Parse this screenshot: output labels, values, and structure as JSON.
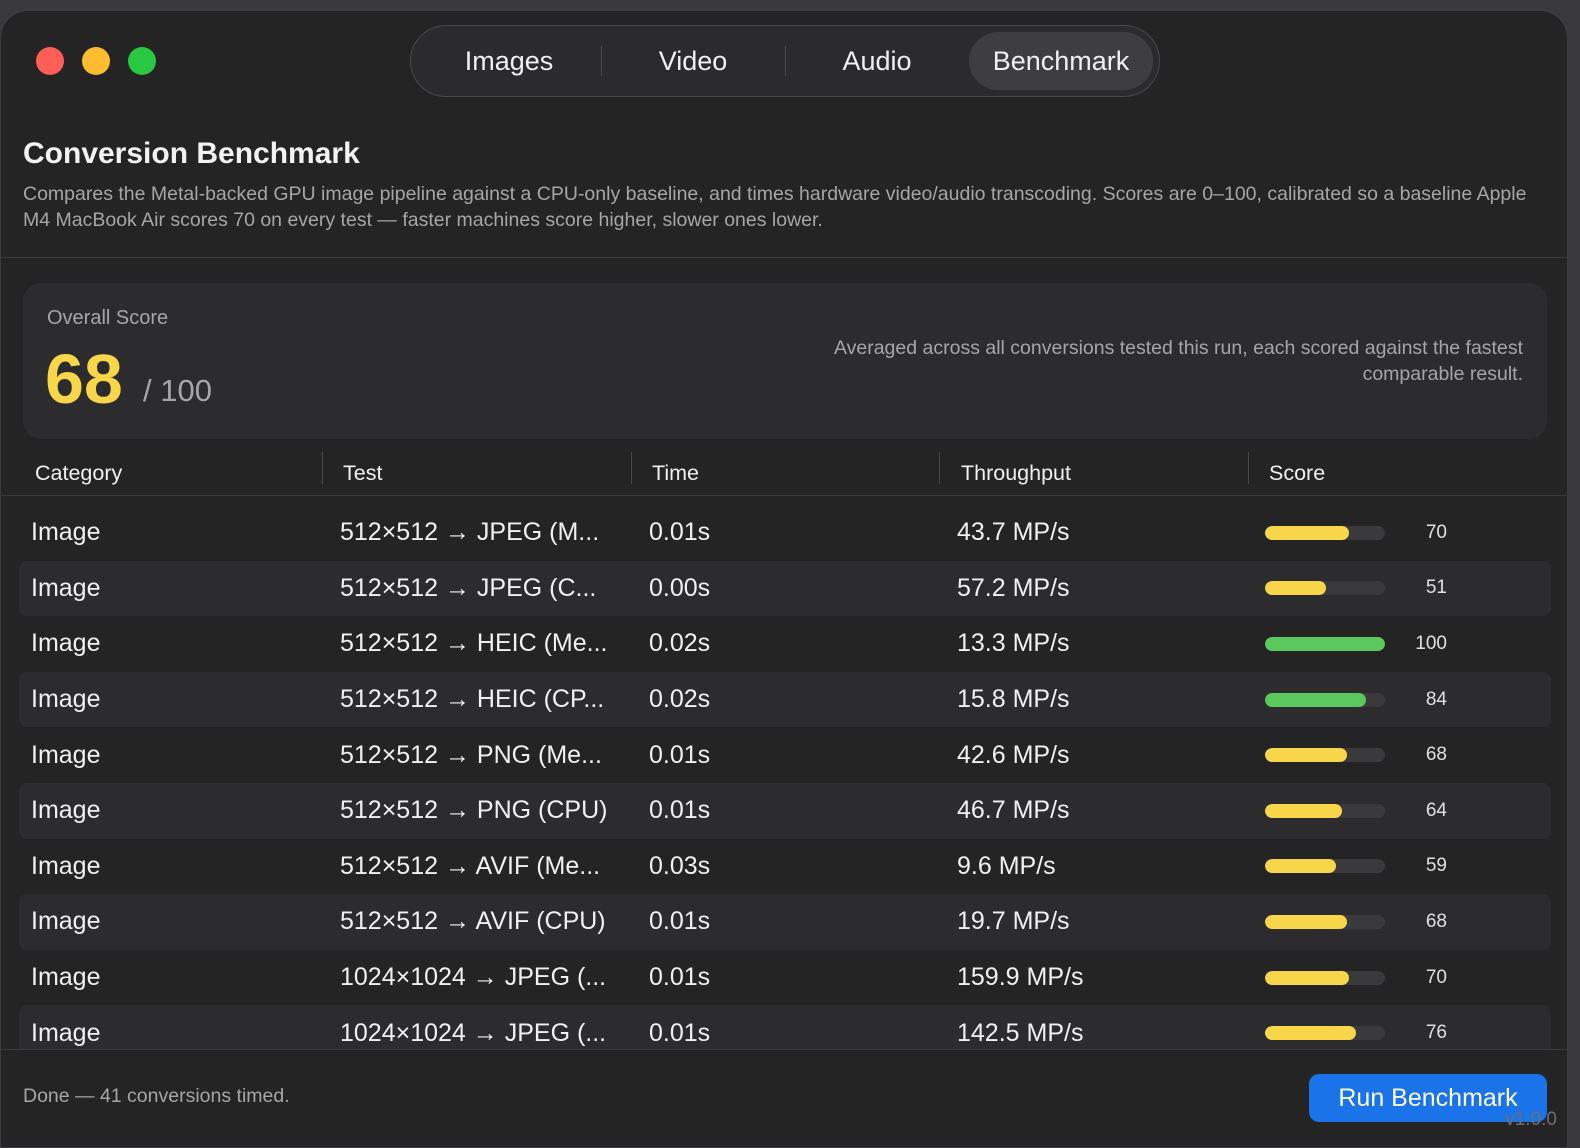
{
  "tabs": [
    {
      "label": "Images",
      "active": false
    },
    {
      "label": "Video",
      "active": false
    },
    {
      "label": "Audio",
      "active": false
    },
    {
      "label": "Benchmark",
      "active": true
    }
  ],
  "header": {
    "title": "Conversion Benchmark",
    "description": "Compares the Metal-backed GPU image pipeline against a CPU-only baseline, and times hardware video/audio transcoding. Scores are 0–100, calibrated so a baseline Apple M4 MacBook Air scores 70 on every test — faster machines score higher, slower ones lower."
  },
  "overall": {
    "label": "Overall Score",
    "score": "68",
    "max": "/ 100",
    "note": "Averaged across all conversions tested this run, each scored against the fastest comparable result."
  },
  "table": {
    "columns": [
      "Category",
      "Test",
      "Time",
      "Throughput",
      "Score"
    ],
    "rows": [
      {
        "category": "Image",
        "test": "512×512 → JPEG (M...",
        "time": "0.01s",
        "throughput": "43.7 MP/s",
        "score": 70
      },
      {
        "category": "Image",
        "test": "512×512 → JPEG (C...",
        "time": "0.00s",
        "throughput": "57.2 MP/s",
        "score": 51
      },
      {
        "category": "Image",
        "test": "512×512 → HEIC (Me...",
        "time": "0.02s",
        "throughput": "13.3 MP/s",
        "score": 100
      },
      {
        "category": "Image",
        "test": "512×512 → HEIC (CP...",
        "time": "0.02s",
        "throughput": "15.8 MP/s",
        "score": 84
      },
      {
        "category": "Image",
        "test": "512×512 → PNG (Me...",
        "time": "0.01s",
        "throughput": "42.6 MP/s",
        "score": 68
      },
      {
        "category": "Image",
        "test": "512×512 → PNG (CPU)",
        "time": "0.01s",
        "throughput": "46.7 MP/s",
        "score": 64
      },
      {
        "category": "Image",
        "test": "512×512 → AVIF (Me...",
        "time": "0.03s",
        "throughput": "9.6 MP/s",
        "score": 59
      },
      {
        "category": "Image",
        "test": "512×512 → AVIF (CPU)",
        "time": "0.01s",
        "throughput": "19.7 MP/s",
        "score": 68
      },
      {
        "category": "Image",
        "test": "1024×1024 → JPEG (...",
        "time": "0.01s",
        "throughput": "159.9 MP/s",
        "score": 70
      },
      {
        "category": "Image",
        "test": "1024×1024 → JPEG (...",
        "time": "0.01s",
        "throughput": "142.5 MP/s",
        "score": 76
      }
    ]
  },
  "colors": {
    "score_high": "#5ac85a",
    "score_mid": "#f7d64a",
    "accent": "#1a73e8"
  },
  "footer": {
    "status": "Done — 41 conversions timed.",
    "run_label": "Run Benchmark",
    "version": "v1.0.0"
  }
}
